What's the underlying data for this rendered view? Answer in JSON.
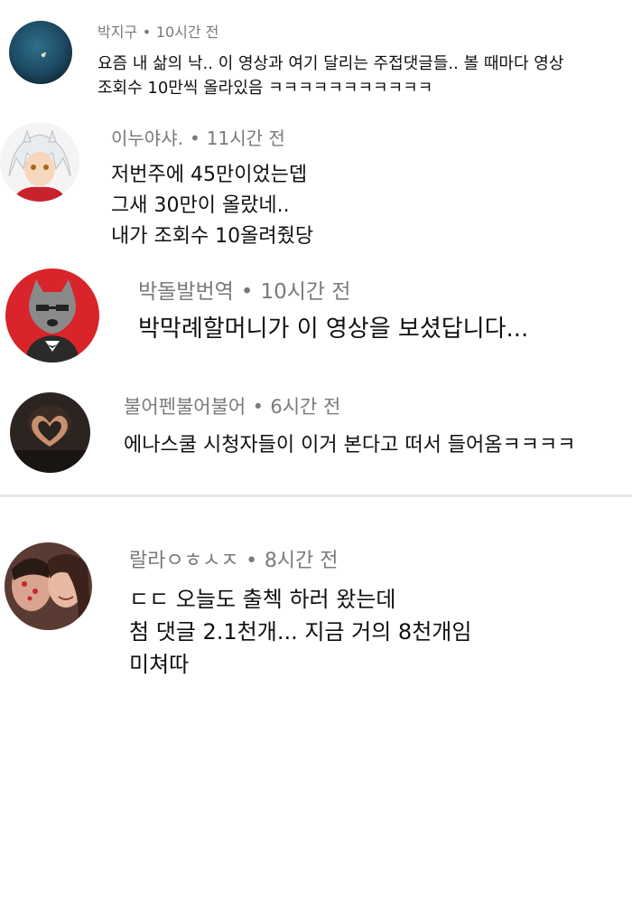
{
  "comments": [
    {
      "author": "박지구",
      "time": "10시간 전",
      "lines": [
        "요즘 내 삶의 낙.. 이 영상과 여기 달리는 주접댓글들.. 볼 때마다 영상",
        "조회수 10만씩 올라있음 ㅋㅋㅋㅋㅋㅋㅋㅋㅋㅋㅋ"
      ]
    },
    {
      "author": "이누야샤.",
      "time": "11시간 전",
      "lines": [
        "저번주에 45만이었는뎁",
        "그새 30만이 올랐네..",
        "내가 조회수 10올려줬당"
      ]
    },
    {
      "author": "박돌발번역",
      "time": "10시간 전",
      "lines": [
        "박막례할머니가 이 영상을 보셨답니다..."
      ]
    },
    {
      "author": "불어펜불어불어",
      "time": "6시간 전",
      "lines": [
        "에나스쿨 시청자들이 이거 본다고 떠서 들어옴ㅋㅋㅋㅋ"
      ]
    },
    {
      "author": "랄라ㅇㅎㅅㅈ",
      "time": "8시간 전",
      "lines": [
        "ㄷㄷ 오늘도 출첵 하러 왔는데",
        "첨 댓글 2.1천개... 지금 거의 8천개임",
        "미쳐따"
      ]
    }
  ],
  "separator": "•",
  "colors": {
    "meta_text": "#7a7a7a",
    "body_text": "#111111",
    "divider": "#e6e6e6"
  }
}
